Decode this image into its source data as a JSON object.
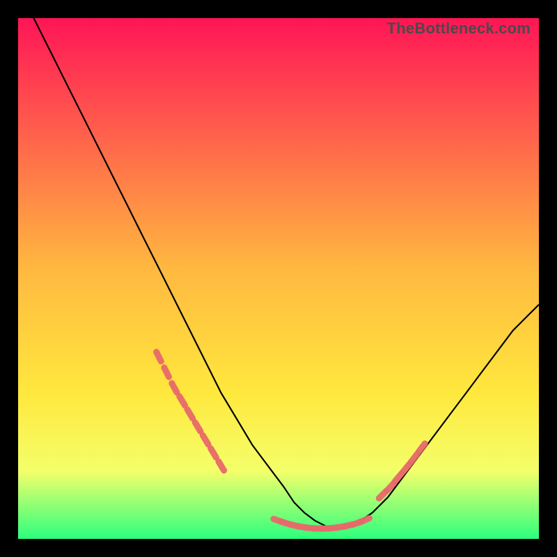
{
  "watermark": "TheBottleneck.com",
  "colors": {
    "gradient_top": "#ff1556",
    "gradient_mid": "#ffde3d",
    "gradient_low": "#f4ff6a",
    "gradient_bottom": "#2cff7e",
    "curve": "#000000",
    "marker_fill": "#e86a6a",
    "marker_stroke": "#d94f4f",
    "frame": "#000000"
  },
  "chart_data": {
    "type": "line",
    "title": "",
    "xlabel": "",
    "ylabel": "",
    "xlim": [
      0,
      100
    ],
    "ylim": [
      0,
      100
    ],
    "grid": false,
    "legend": false,
    "series": [
      {
        "name": "bottleneck-curve",
        "x": [
          3,
          6,
          9,
          12,
          15,
          18,
          21,
          24,
          27,
          30,
          33,
          36,
          39,
          42,
          45,
          48,
          51,
          53,
          55,
          57,
          59,
          61,
          63,
          65,
          68,
          71,
          74,
          77,
          80,
          83,
          86,
          89,
          92,
          95,
          98,
          100
        ],
        "values": [
          100,
          94,
          88,
          82,
          76,
          70,
          64,
          58,
          52,
          46,
          40,
          34,
          28,
          23,
          18,
          14,
          10,
          7,
          5,
          3.5,
          2.5,
          2,
          2,
          3,
          5,
          8,
          12,
          16,
          20,
          24,
          28,
          32,
          36,
          40,
          43,
          45
        ]
      }
    ],
    "markers": [
      {
        "name": "cluster-left-slope",
        "x": [
          27,
          28.5,
          30,
          31.5,
          33,
          34.5,
          36,
          37.5,
          39
        ],
        "values": [
          35,
          32,
          29,
          26.5,
          24,
          21.5,
          19,
          16.5,
          14
        ]
      },
      {
        "name": "cluster-valley",
        "x": [
          50,
          51.5,
          53,
          54.5,
          56,
          57.5,
          59,
          60.5,
          62,
          63.5,
          65,
          66.5
        ],
        "values": [
          3.5,
          3.0,
          2.6,
          2.3,
          2.1,
          2.0,
          2.0,
          2.1,
          2.3,
          2.6,
          3.0,
          3.6
        ]
      },
      {
        "name": "cluster-right-slope",
        "x": [
          70,
          71.5,
          73,
          74.5,
          76,
          77.5
        ],
        "values": [
          8.5,
          10,
          11.8,
          13.6,
          15.5,
          17.5
        ]
      }
    ]
  }
}
